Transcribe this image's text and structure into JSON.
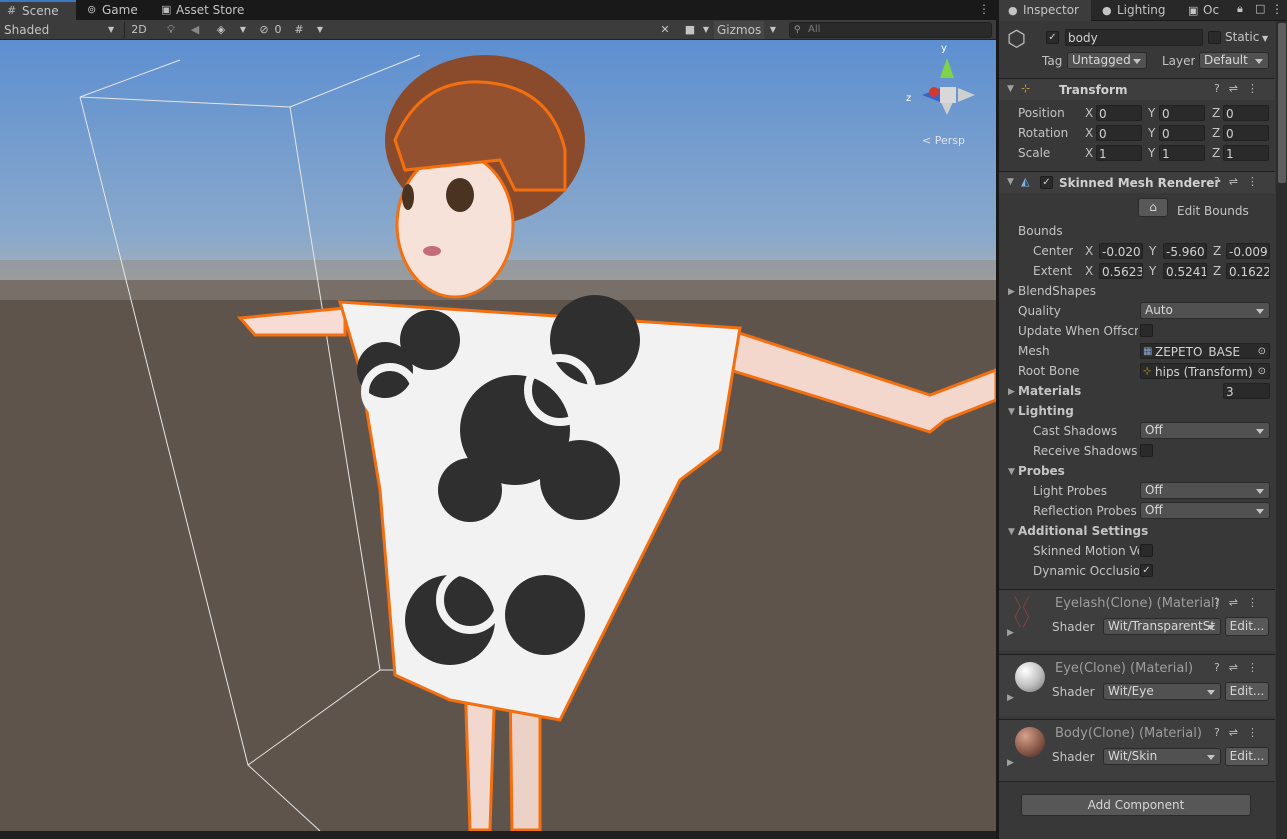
{
  "scene": {
    "tabs": [
      {
        "label": "Scene",
        "icon": "grid-icon"
      },
      {
        "label": "Game",
        "icon": "gamepad-icon"
      },
      {
        "label": "Asset Store",
        "icon": "store-icon"
      }
    ],
    "shading_mode": "Shaded",
    "mode_2d": "2D",
    "hidden_count": "0",
    "gizmos_label": "Gizmos",
    "search_placeholder": "All",
    "persp_label": "< Persp",
    "axis_y": "y",
    "axis_z": "z"
  },
  "inspector": {
    "tabs": [
      {
        "label": "Inspector",
        "icon": "info-icon"
      },
      {
        "label": "Lighting",
        "icon": "bulb-icon"
      },
      {
        "label": "Oc",
        "icon": "occlusion-icon"
      }
    ],
    "object": {
      "name": "body",
      "active": true,
      "static_label": "Static",
      "tag_label": "Tag",
      "tag_value": "Untagged",
      "layer_label": "Layer",
      "layer_value": "Default"
    },
    "transform": {
      "title": "Transform",
      "rows": [
        {
          "label": "Position",
          "x": "0",
          "y": "0",
          "z": "0"
        },
        {
          "label": "Rotation",
          "x": "0",
          "y": "0",
          "z": "0"
        },
        {
          "label": "Scale",
          "x": "1",
          "y": "1",
          "z": "1"
        }
      ]
    },
    "smr": {
      "title": "Skinned Mesh Renderer",
      "enabled": true,
      "edit_bounds_label": "Edit Bounds",
      "bounds_label": "Bounds",
      "center_label": "Center",
      "center": {
        "x": "-0.020",
        "y": "-5.960",
        "z": "-0.009"
      },
      "extent_label": "Extent",
      "extent": {
        "x": "0.5623",
        "y": "0.5241",
        "z": "0.1622"
      },
      "blendshapes_label": "BlendShapes",
      "quality_label": "Quality",
      "quality_value": "Auto",
      "update_offscreen_label": "Update When Offscre",
      "mesh_label": "Mesh",
      "mesh_value": "ZEPETO_BASE",
      "root_bone_label": "Root Bone",
      "root_bone_value": "hips (Transform)",
      "materials_label": "Materials",
      "materials_count": "3",
      "lighting_label": "Lighting",
      "cast_shadows_label": "Cast Shadows",
      "cast_shadows_value": "Off",
      "receive_shadows_label": "Receive Shadows",
      "probes_label": "Probes",
      "light_probes_label": "Light Probes",
      "light_probes_value": "Off",
      "reflection_probes_label": "Reflection Probes",
      "reflection_probes_value": "Off",
      "additional_label": "Additional Settings",
      "motion_vectors_label": "Skinned Motion Ve",
      "dynamic_occlusion_label": "Dynamic Occlusior",
      "dynamic_occlusion_checked": true
    },
    "materials": [
      {
        "title": "Eyelash(Clone) (Material)",
        "shader_label": "Shader",
        "shader": "Wit/TransparentSt",
        "edit": "Edit...",
        "color": "#3a3a3a"
      },
      {
        "title": "Eye(Clone) (Material)",
        "shader_label": "Shader",
        "shader": "Wit/Eye",
        "edit": "Edit...",
        "color": "#d8d8d8"
      },
      {
        "title": "Body(Clone) (Material)",
        "shader_label": "Shader",
        "shader": "Wit/Skin",
        "edit": "Edit...",
        "color": "#8a5a4a"
      }
    ],
    "add_component_label": "Add Component"
  }
}
